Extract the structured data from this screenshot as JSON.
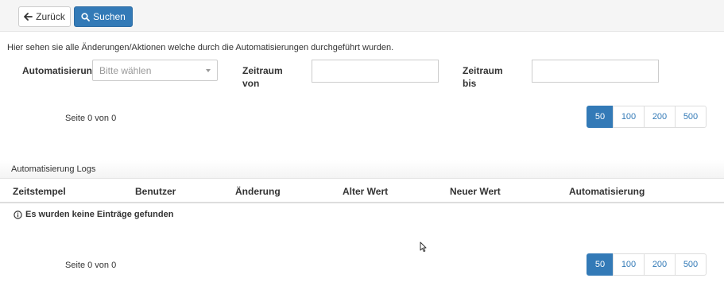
{
  "toolbar": {
    "back_label": "Zurück",
    "search_label": "Suchen"
  },
  "intro_text": "Hier sehen sie alle Änderungen/Aktionen welche durch die Automatisierungen durchgeführt wurden.",
  "filters": {
    "automation_label": "Automatisierung",
    "automation_placeholder": "Bitte wählen",
    "from_label_line1": "Zeitraum",
    "from_label_line2": "von",
    "to_label_line1": "Zeitraum",
    "to_label_line2": "bis",
    "from_value": "",
    "to_value": ""
  },
  "pagination": {
    "info": "Seite 0 von 0",
    "sizes": [
      "50",
      "100",
      "200",
      "500"
    ],
    "active_size": "50"
  },
  "panel": {
    "title": "Automatisierung Logs",
    "columns": [
      "Zeitstempel",
      "Benutzer",
      "Änderung",
      "Alter Wert",
      "Neuer Wert",
      "Automatisierung"
    ],
    "empty_message": "Es wurden keine Einträge gefunden"
  },
  "icons": {
    "back": "arrow-left-icon",
    "search": "search-icon",
    "caret": "chevron-down-icon",
    "info": "info-circle-icon",
    "cursor": "mouse-cursor-icon"
  },
  "colors": {
    "primary": "#337ab7",
    "toolbar_bg": "#f5f5f5",
    "link": "#337ab7"
  }
}
